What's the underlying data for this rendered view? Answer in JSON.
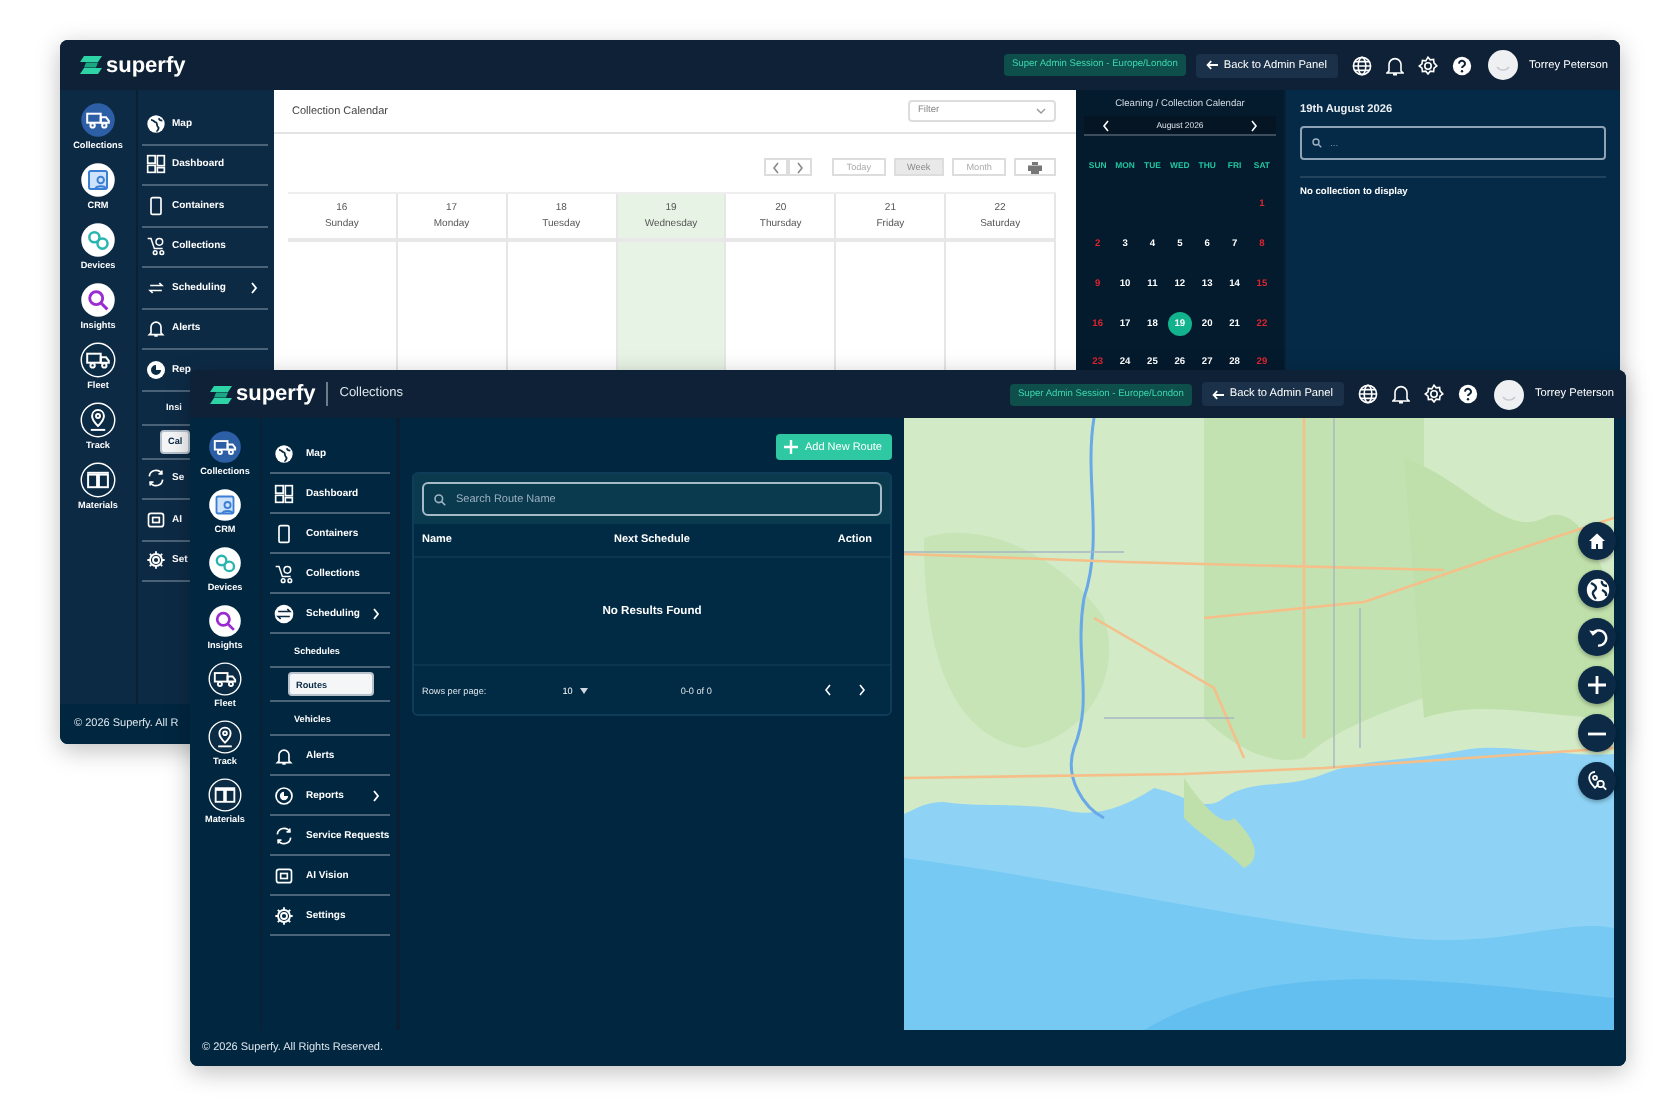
{
  "back_window": {
    "header": {
      "logo": "superfy",
      "session_badge": "Super Admin Session - Europe/London",
      "back_button": "Back to Admin Panel",
      "user_name": "Torrey Peterson"
    },
    "rail": [
      {
        "label": "Collections",
        "selected": true,
        "kind": "filled"
      },
      {
        "label": "CRM",
        "selected": false,
        "kind": "filled"
      },
      {
        "label": "Devices",
        "selected": false,
        "kind": "filled"
      },
      {
        "label": "Insights",
        "selected": false,
        "kind": "filled"
      },
      {
        "label": "Fleet",
        "selected": false,
        "kind": "outline"
      },
      {
        "label": "Track",
        "selected": false,
        "kind": "outline"
      },
      {
        "label": "Materials",
        "selected": false,
        "kind": "outline"
      }
    ],
    "nav": [
      {
        "label": "Map",
        "selected": false
      },
      {
        "label": "Dashboard",
        "selected": false
      },
      {
        "label": "Containers",
        "selected": false
      },
      {
        "label": "Collections",
        "selected": false
      },
      {
        "label": "Scheduling",
        "selected": false,
        "has_submenu": true
      },
      {
        "label": "Alerts",
        "selected": false
      },
      {
        "label": "Rep",
        "selected": false,
        "expanded": true,
        "children": [
          {
            "label": "Insi",
            "selected": false
          },
          {
            "label": "Cal",
            "selected": true
          }
        ]
      },
      {
        "label": "Se",
        "selected": false
      },
      {
        "label": "AI",
        "selected": false
      },
      {
        "label": "Set",
        "selected": false
      }
    ],
    "calendar": {
      "title": "Collection Calendar",
      "filter_placeholder": "Filter",
      "view_buttons": [
        {
          "label": "Today",
          "selected": false
        },
        {
          "label": "Week",
          "selected": true
        },
        {
          "label": "Month",
          "selected": false
        }
      ],
      "days": [
        {
          "date": "16",
          "weekday": "Sunday",
          "selected": false
        },
        {
          "date": "17",
          "weekday": "Monday",
          "selected": false
        },
        {
          "date": "18",
          "weekday": "Tuesday",
          "selected": false
        },
        {
          "date": "19",
          "weekday": "Wednesday",
          "selected": true
        },
        {
          "date": "20",
          "weekday": "Thursday",
          "selected": false
        },
        {
          "date": "21",
          "weekday": "Friday",
          "selected": false
        },
        {
          "date": "22",
          "weekday": "Saturday",
          "selected": false
        }
      ]
    },
    "mini_calendar": {
      "title": "Cleaning / Collection Calendar",
      "month": "August 2026",
      "weekdays": [
        "SUN",
        "MON",
        "TUE",
        "WED",
        "THU",
        "FRI",
        "SAT"
      ],
      "weeks": [
        [
          {
            "day": "1",
            "weekend": true,
            "selected": false
          }
        ],
        [
          {
            "day": "2",
            "weekend": true,
            "selected": false
          },
          {
            "day": "3",
            "weekend": false,
            "selected": false
          },
          {
            "day": "4",
            "weekend": false,
            "selected": false
          },
          {
            "day": "5",
            "weekend": false,
            "selected": false
          },
          {
            "day": "6",
            "weekend": false,
            "selected": false
          },
          {
            "day": "7",
            "weekend": false,
            "selected": false
          },
          {
            "day": "8",
            "weekend": true,
            "selected": false
          }
        ],
        [
          {
            "day": "9",
            "weekend": true,
            "selected": false
          },
          {
            "day": "10",
            "weekend": false,
            "selected": false
          },
          {
            "day": "11",
            "weekend": false,
            "selected": false
          },
          {
            "day": "12",
            "weekend": false,
            "selected": false
          },
          {
            "day": "13",
            "weekend": false,
            "selected": false
          },
          {
            "day": "14",
            "weekend": false,
            "selected": false
          },
          {
            "day": "15",
            "weekend": true,
            "selected": false
          }
        ],
        [
          {
            "day": "16",
            "weekend": true,
            "selected": false
          },
          {
            "day": "17",
            "weekend": false,
            "selected": false
          },
          {
            "day": "18",
            "weekend": false,
            "selected": false
          },
          {
            "day": "19",
            "weekend": false,
            "selected": true
          },
          {
            "day": "20",
            "weekend": false,
            "selected": false
          },
          {
            "day": "21",
            "weekend": false,
            "selected": false
          },
          {
            "day": "22",
            "weekend": true,
            "selected": false
          }
        ],
        [
          {
            "day": "23",
            "weekend": true,
            "selected": false
          },
          {
            "day": "24",
            "weekend": false,
            "selected": false
          },
          {
            "day": "25",
            "weekend": false,
            "selected": false
          },
          {
            "day": "26",
            "weekend": false,
            "selected": false
          },
          {
            "day": "27",
            "weekend": false,
            "selected": false
          },
          {
            "day": "28",
            "weekend": false,
            "selected": false
          },
          {
            "day": "29",
            "weekend": true,
            "selected": false
          }
        ]
      ]
    },
    "details": {
      "date_title": "19th August 2026",
      "search_placeholder": "...",
      "empty_message": "No collection to display"
    },
    "footer": "© 2026 Superfy. All R"
  },
  "front_window": {
    "header": {
      "logo": "superfy",
      "section": "Collections",
      "session_badge": "Super Admin Session - Europe/London",
      "back_button": "Back to Admin Panel",
      "user_name": "Torrey Peterson"
    },
    "rail": [
      {
        "label": "Collections",
        "selected": true,
        "kind": "filled"
      },
      {
        "label": "CRM",
        "selected": false,
        "kind": "filled"
      },
      {
        "label": "Devices",
        "selected": false,
        "kind": "filled"
      },
      {
        "label": "Insights",
        "selected": false,
        "kind": "filled"
      },
      {
        "label": "Fleet",
        "selected": false,
        "kind": "outline"
      },
      {
        "label": "Track",
        "selected": false,
        "kind": "outline"
      },
      {
        "label": "Materials",
        "selected": false,
        "kind": "outline"
      }
    ],
    "nav": [
      {
        "label": "Map",
        "selected": false
      },
      {
        "label": "Dashboard",
        "selected": false
      },
      {
        "label": "Containers",
        "selected": false
      },
      {
        "label": "Collections",
        "selected": false
      },
      {
        "label": "Scheduling",
        "selected": false,
        "has_submenu": true,
        "expanded": true,
        "children": [
          {
            "label": "Schedules",
            "selected": false
          },
          {
            "label": "Routes",
            "selected": true
          },
          {
            "label": "Vehicles",
            "selected": false
          }
        ]
      },
      {
        "label": "Alerts",
        "selected": false
      },
      {
        "label": "Reports",
        "selected": false,
        "has_submenu": true
      },
      {
        "label": "Service Requests",
        "selected": false
      },
      {
        "label": "AI Vision",
        "selected": false
      },
      {
        "label": "Settings",
        "selected": false
      }
    ],
    "routes": {
      "add_button": "Add New Route",
      "search_placeholder": "Search Route Name",
      "columns": [
        "Name",
        "Next Schedule",
        "Action"
      ],
      "empty_message": "No Results Found",
      "rows_per_page_label": "Rows per page:",
      "rows_per_page": "10",
      "range": "0-0 of 0"
    },
    "footer": "© 2026 Superfy. All Rights Reserved."
  }
}
